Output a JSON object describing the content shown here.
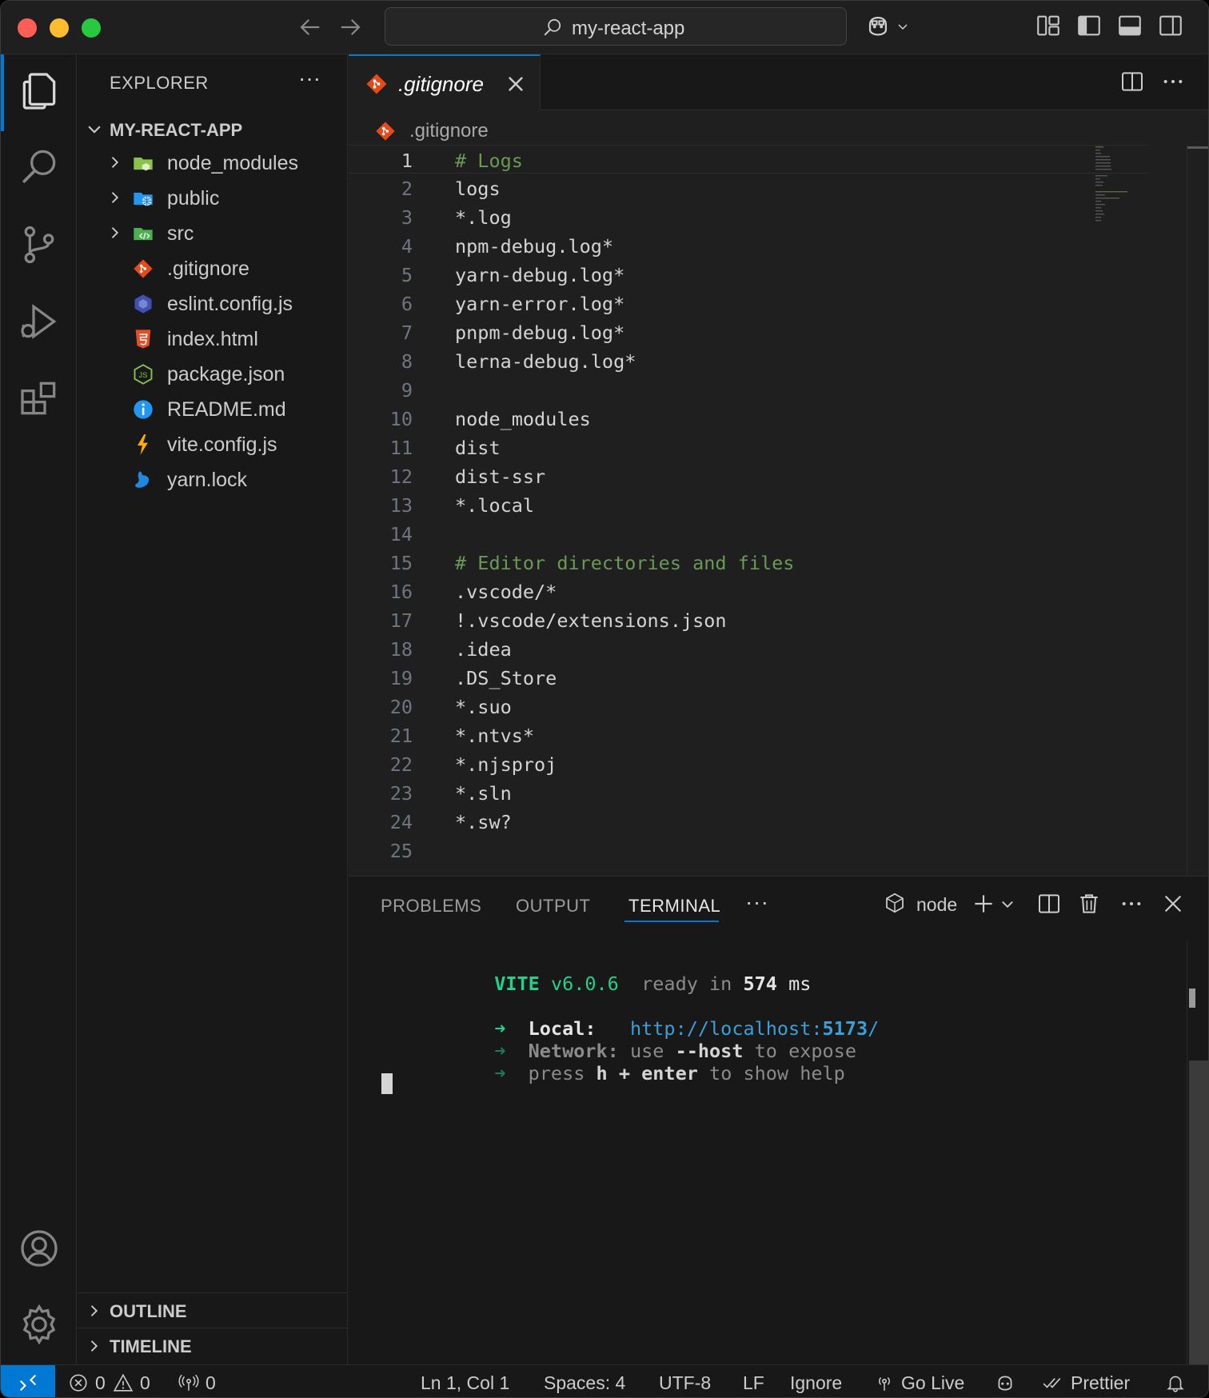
{
  "titlebar": {
    "search_text": "my-react-app"
  },
  "sidebar": {
    "title": "EXPLORER",
    "more": "···",
    "root": "MY-REACT-APP",
    "items": [
      {
        "label": "node_modules",
        "type": "folder",
        "icon": "folder-node-icon"
      },
      {
        "label": "public",
        "type": "folder",
        "icon": "folder-public-icon"
      },
      {
        "label": "src",
        "type": "folder",
        "icon": "folder-src-icon"
      },
      {
        "label": ".gitignore",
        "type": "file",
        "icon": "git-icon"
      },
      {
        "label": "eslint.config.js",
        "type": "file",
        "icon": "eslint-icon"
      },
      {
        "label": "index.html",
        "type": "file",
        "icon": "html-icon"
      },
      {
        "label": "package.json",
        "type": "file",
        "icon": "nodejs-icon"
      },
      {
        "label": "README.md",
        "type": "file",
        "icon": "info-icon"
      },
      {
        "label": "vite.config.js",
        "type": "file",
        "icon": "vite-icon"
      },
      {
        "label": "yarn.lock",
        "type": "file",
        "icon": "yarn-icon"
      }
    ],
    "outline": "OUTLINE",
    "timeline": "TIMELINE"
  },
  "editor": {
    "tab_label": ".gitignore",
    "breadcrumb": ".gitignore",
    "lines": [
      {
        "n": "1",
        "text": "# Logs",
        "comment": true
      },
      {
        "n": "2",
        "text": "logs"
      },
      {
        "n": "3",
        "text": "*.log"
      },
      {
        "n": "4",
        "text": "npm-debug.log*"
      },
      {
        "n": "5",
        "text": "yarn-debug.log*"
      },
      {
        "n": "6",
        "text": "yarn-error.log*"
      },
      {
        "n": "7",
        "text": "pnpm-debug.log*"
      },
      {
        "n": "8",
        "text": "lerna-debug.log*"
      },
      {
        "n": "9",
        "text": ""
      },
      {
        "n": "10",
        "text": "node_modules"
      },
      {
        "n": "11",
        "text": "dist"
      },
      {
        "n": "12",
        "text": "dist-ssr"
      },
      {
        "n": "13",
        "text": "*.local"
      },
      {
        "n": "14",
        "text": ""
      },
      {
        "n": "15",
        "text": "# Editor directories and files",
        "comment": true
      },
      {
        "n": "16",
        "text": ".vscode/*"
      },
      {
        "n": "17",
        "text": "!.vscode/extensions.json"
      },
      {
        "n": "18",
        "text": ".idea"
      },
      {
        "n": "19",
        "text": ".DS_Store"
      },
      {
        "n": "20",
        "text": "*.suo"
      },
      {
        "n": "21",
        "text": "*.ntvs*"
      },
      {
        "n": "22",
        "text": "*.njsproj"
      },
      {
        "n": "23",
        "text": "*.sln"
      },
      {
        "n": "24",
        "text": "*.sw?"
      },
      {
        "n": "25",
        "text": ""
      }
    ]
  },
  "panel": {
    "tabs": [
      "PROBLEMS",
      "OUTPUT",
      "TERMINAL"
    ],
    "active_tab": "TERMINAL",
    "more": "···",
    "shell": "node",
    "terminal": {
      "vite_name": "VITE",
      "vite_version": "v6.0.6",
      "ready_text": "ready in",
      "ready_ms": "574",
      "ms_unit": "ms",
      "arrow": "➜",
      "local_label": "Local:",
      "local_url_prefix": "http://localhost:",
      "local_port": "5173",
      "local_url_suffix": "/",
      "network_label": "Network:",
      "network_use": "use",
      "network_flag": "--host",
      "network_rest": "to expose",
      "press": "press",
      "key_h": "h + enter",
      "help_rest": "to show help"
    }
  },
  "statusbar": {
    "errors": "0",
    "warnings": "0",
    "ports": "0",
    "position": "Ln 1, Col 1",
    "spaces": "Spaces: 4",
    "encoding": "UTF-8",
    "eol": "LF",
    "language": "Ignore",
    "golive": "Go Live",
    "prettier": "Prettier"
  },
  "colors": {
    "accent": "#0078d4",
    "comment": "#6a9955",
    "vite_green": "#23d18b",
    "link": "#3b9fd8"
  }
}
